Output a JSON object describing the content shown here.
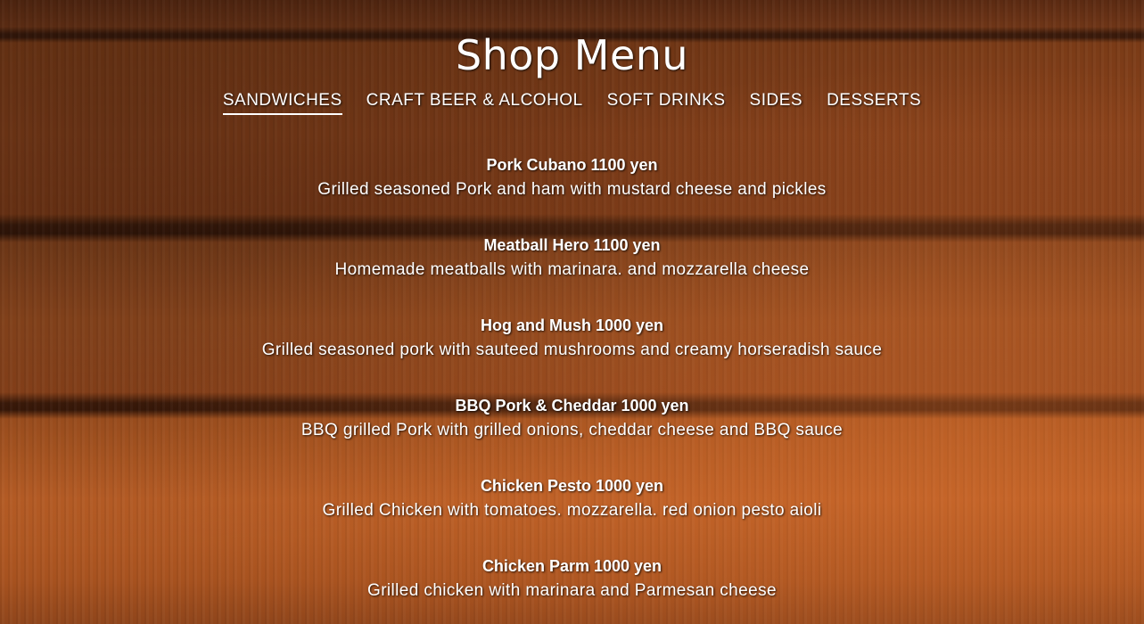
{
  "page": {
    "title": "Shop Menu"
  },
  "tabs": [
    {
      "label": "SANDWICHES",
      "active": true
    },
    {
      "label": "CRAFT BEER & ALCOHOL",
      "active": false
    },
    {
      "label": "SOFT DRINKS",
      "active": false
    },
    {
      "label": "SIDES",
      "active": false
    },
    {
      "label": "DESSERTS",
      "active": false
    }
  ],
  "items": [
    {
      "name": "Pork Cubano 1100 yen",
      "description": "Grilled seasoned Pork and ham with mustard cheese and pickles"
    },
    {
      "name": "Meatball Hero 1100 yen",
      "description": "Homemade meatballs with marinara. and mozzarella cheese"
    },
    {
      "name": "Hog and Mush 1000 yen",
      "description": "Grilled seasoned pork with sauteed mushrooms and creamy horseradish sauce"
    },
    {
      "name": "BBQ Pork & Cheddar 1000 yen",
      "description": "BBQ grilled Pork with grilled onions, cheddar cheese and BBQ sauce"
    },
    {
      "name": "Chicken Pesto 1000 yen",
      "description": "Grilled Chicken with tomatoes. mozzarella. red onion pesto aioli"
    },
    {
      "name": "Chicken Parm 1000 yen",
      "description": "Grilled chicken with marinara and Parmesan cheese"
    }
  ],
  "colors": {
    "text": "#ffffff",
    "background_wood": "#944a1e"
  }
}
